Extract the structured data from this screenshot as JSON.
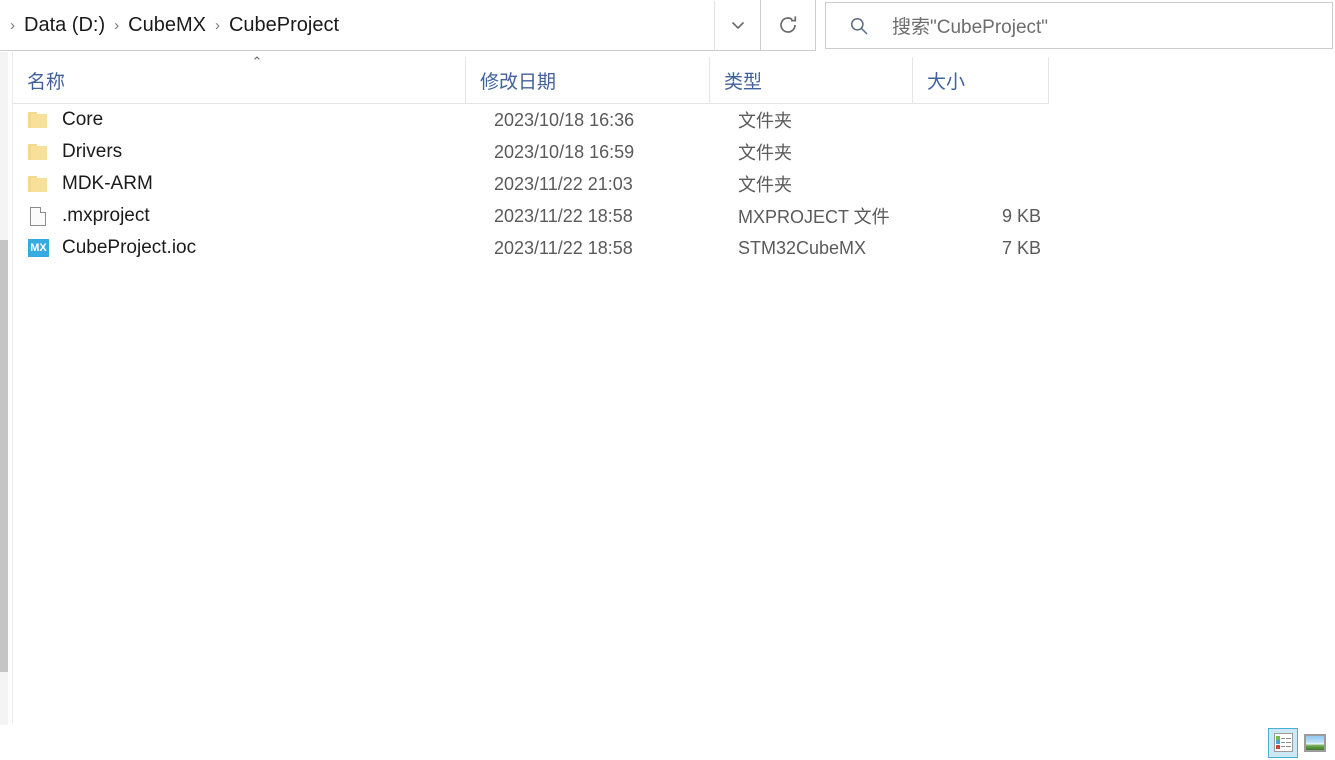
{
  "addressbar": {
    "breadcrumbs": [
      {
        "label": "Data (D:)"
      },
      {
        "label": "CubeMX"
      },
      {
        "label": "CubeProject"
      }
    ],
    "separator": "›",
    "dropdown_icon": "chevron-down-icon",
    "refresh_icon": "refresh-icon"
  },
  "search": {
    "icon": "search-icon",
    "placeholder": "搜索\"CubeProject\"",
    "value": ""
  },
  "columns": [
    {
      "key": "name",
      "label": "名称",
      "sort": "ascending",
      "sort_glyph": "⌃"
    },
    {
      "key": "date",
      "label": "修改日期"
    },
    {
      "key": "type",
      "label": "类型"
    },
    {
      "key": "size",
      "label": "大小"
    }
  ],
  "files": [
    {
      "icon": "folder-icon",
      "name": "Core",
      "date": "2023/10/18 16:36",
      "type": "文件夹",
      "size": ""
    },
    {
      "icon": "folder-icon",
      "name": "Drivers",
      "date": "2023/10/18 16:59",
      "type": "文件夹",
      "size": ""
    },
    {
      "icon": "folder-icon",
      "name": "MDK-ARM",
      "date": "2023/11/22 21:03",
      "type": "文件夹",
      "size": ""
    },
    {
      "icon": "document-icon",
      "name": ".mxproject",
      "date": "2023/11/22 18:58",
      "type": "MXPROJECT 文件",
      "size": "9 KB"
    },
    {
      "icon": "stm32cubemx-icon",
      "icon_text": "MX",
      "name": "CubeProject.ioc",
      "date": "2023/11/22 18:58",
      "type": "STM32CubeMX",
      "size": "7 KB"
    }
  ],
  "statusbar": {
    "item_count_text": "",
    "view_buttons": [
      {
        "name": "details-view-button",
        "icon": "details-view-icon",
        "active": true
      },
      {
        "name": "large-icons-view-button",
        "icon": "thumbnail-view-icon",
        "active": false
      }
    ]
  },
  "colors": {
    "header_text": "#41619c",
    "folder_icon": "#f7e09a",
    "cubemx_icon": "#37abe0",
    "selection_highlight": "#cce8f4",
    "body_text": "#1b1b1b",
    "meta_text": "#5a5a5a"
  }
}
